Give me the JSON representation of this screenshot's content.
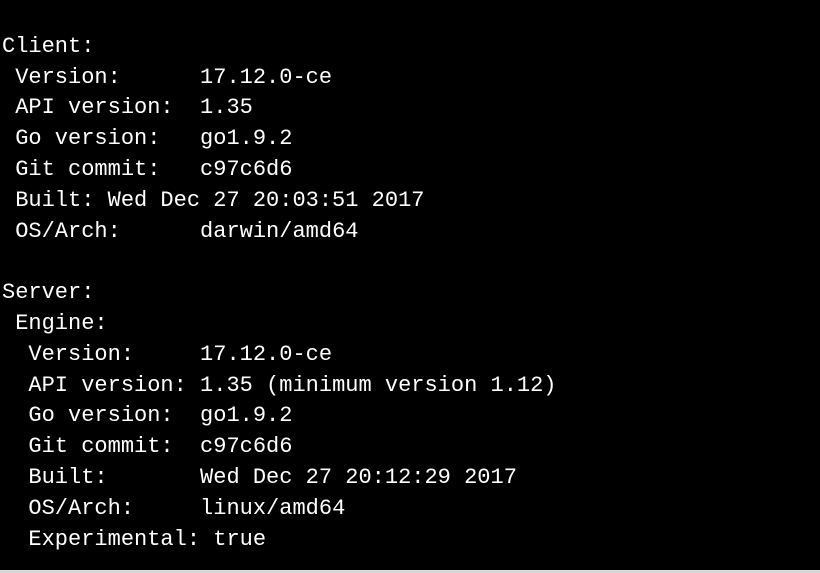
{
  "client": {
    "header": "Client:",
    "rows": [
      {
        "label": " Version:",
        "pad": "      ",
        "value": "17.12.0-ce"
      },
      {
        "label": " API version:",
        "pad": "  ",
        "value": "1.35"
      },
      {
        "label": " Go version:",
        "pad": "   ",
        "value": "go1.9.2"
      },
      {
        "label": " Git commit:",
        "pad": "   ",
        "value": "c97c6d6"
      },
      {
        "label": " Built:",
        "pad": " ",
        "value": "Wed Dec 27 20:03:51 2017"
      },
      {
        "label": " OS/Arch:",
        "pad": "      ",
        "value": "darwin/amd64"
      }
    ]
  },
  "server": {
    "header": "Server:",
    "engine_header": " Engine:",
    "rows": [
      {
        "label": "  Version:",
        "pad": "     ",
        "value": "17.12.0-ce"
      },
      {
        "label": "  API version:",
        "pad": " ",
        "value": "1.35 (minimum version 1.12)"
      },
      {
        "label": "  Go version:",
        "pad": "  ",
        "value": "go1.9.2"
      },
      {
        "label": "  Git commit:",
        "pad": "  ",
        "value": "c97c6d6"
      },
      {
        "label": "  Built:",
        "pad": "       ",
        "value": "Wed Dec 27 20:12:29 2017"
      },
      {
        "label": "  OS/Arch:",
        "pad": "     ",
        "value": "linux/amd64"
      },
      {
        "label": "  Experimental:",
        "pad": " ",
        "value": "true"
      }
    ]
  }
}
